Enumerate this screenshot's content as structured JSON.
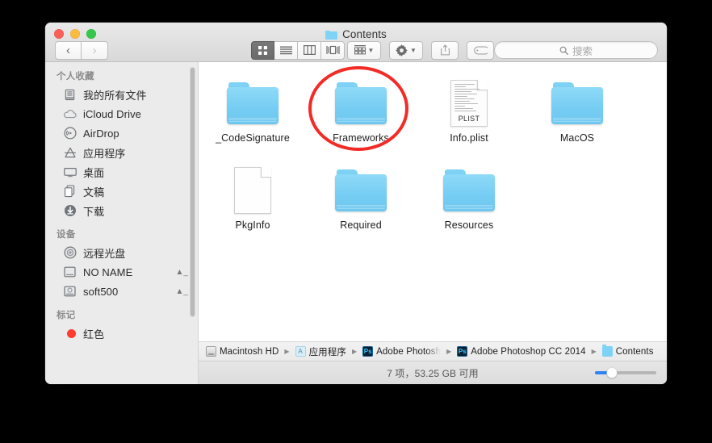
{
  "window": {
    "title": "Contents",
    "title_icon": "folder-icon",
    "traffic_lights": [
      {
        "name": "close-button",
        "color": "#fc6058"
      },
      {
        "name": "minimize-button",
        "color": "#fdbc40"
      },
      {
        "name": "maximize-button",
        "color": "#34c749"
      }
    ]
  },
  "toolbar": {
    "back_icon": "chevron-left-icon",
    "forward_icon": "chevron-right-icon",
    "view_modes": [
      {
        "name": "icon-view",
        "icon": "grid-icon",
        "active": true
      },
      {
        "name": "list-view",
        "icon": "list-icon",
        "active": false
      },
      {
        "name": "column-view",
        "icon": "columns-icon",
        "active": false
      },
      {
        "name": "cover-flow",
        "icon": "coverflow-icon",
        "active": false
      }
    ],
    "arrange_icon": "arrange-icon",
    "action_icon": "gear-icon",
    "share_icon": "share-icon",
    "tag_icon": "tag-icon",
    "caret_icon": "chevron-down-icon"
  },
  "search": {
    "icon": "search-icon",
    "placeholder": "搜索",
    "value": ""
  },
  "sidebar": {
    "sections": [
      {
        "header": "个人收藏",
        "items": [
          {
            "label": "我的所有文件",
            "icon": "all-my-files-icon"
          },
          {
            "label": "iCloud Drive",
            "icon": "cloud-icon"
          },
          {
            "label": "AirDrop",
            "icon": "airdrop-icon"
          },
          {
            "label": "应用程序",
            "icon": "applications-icon"
          },
          {
            "label": "桌面",
            "icon": "desktop-icon"
          },
          {
            "label": "文稿",
            "icon": "documents-icon"
          },
          {
            "label": "下载",
            "icon": "downloads-icon"
          }
        ]
      },
      {
        "header": "设备",
        "items": [
          {
            "label": "远程光盘",
            "icon": "remote-disc-icon",
            "eject": false
          },
          {
            "label": "NO NAME",
            "icon": "hard-disk-icon",
            "eject": true
          },
          {
            "label": "soft500",
            "icon": "external-disk-icon",
            "eject": true
          }
        ]
      },
      {
        "header": "标记",
        "items": [
          {
            "label": "红色",
            "icon": "tag-dot-icon",
            "color": "#ff3b30"
          }
        ]
      }
    ]
  },
  "content": {
    "rows": [
      [
        {
          "name": "_CodeSignature",
          "type": "folder",
          "highlighted": false
        },
        {
          "name": "Frameworks",
          "type": "folder",
          "highlighted": true
        },
        {
          "name": "Info.plist",
          "type": "plist",
          "badge": "PLIST",
          "highlighted": false
        },
        {
          "name": "MacOS",
          "type": "folder",
          "highlighted": false
        }
      ],
      [
        {
          "name": "PkgInfo",
          "type": "document",
          "highlighted": false
        },
        {
          "name": "Required",
          "type": "folder",
          "highlighted": false
        },
        {
          "name": "Resources",
          "type": "folder",
          "highlighted": false
        }
      ]
    ],
    "annotation": {
      "shape": "circle",
      "color": "#f22b26",
      "target": "Frameworks"
    }
  },
  "pathbar": {
    "crumbs": [
      {
        "label": "Macintosh HD",
        "icon": "hard-disk-icon"
      },
      {
        "label": "应用程序",
        "icon": "applications-icon"
      },
      {
        "label": "Adobe Photosh",
        "icon": "photoshop-icon",
        "truncated": true
      },
      {
        "label": "Adobe Photoshop CC 2014",
        "icon": "photoshop-icon"
      },
      {
        "label": "Contents",
        "icon": "folder-icon"
      }
    ],
    "separator": "▶",
    "ps_badge": "Ps"
  },
  "statusbar": {
    "text": "7 项，53.25 GB 可用",
    "zoom_slider": {
      "value": 28,
      "min": 0,
      "max": 100
    }
  }
}
